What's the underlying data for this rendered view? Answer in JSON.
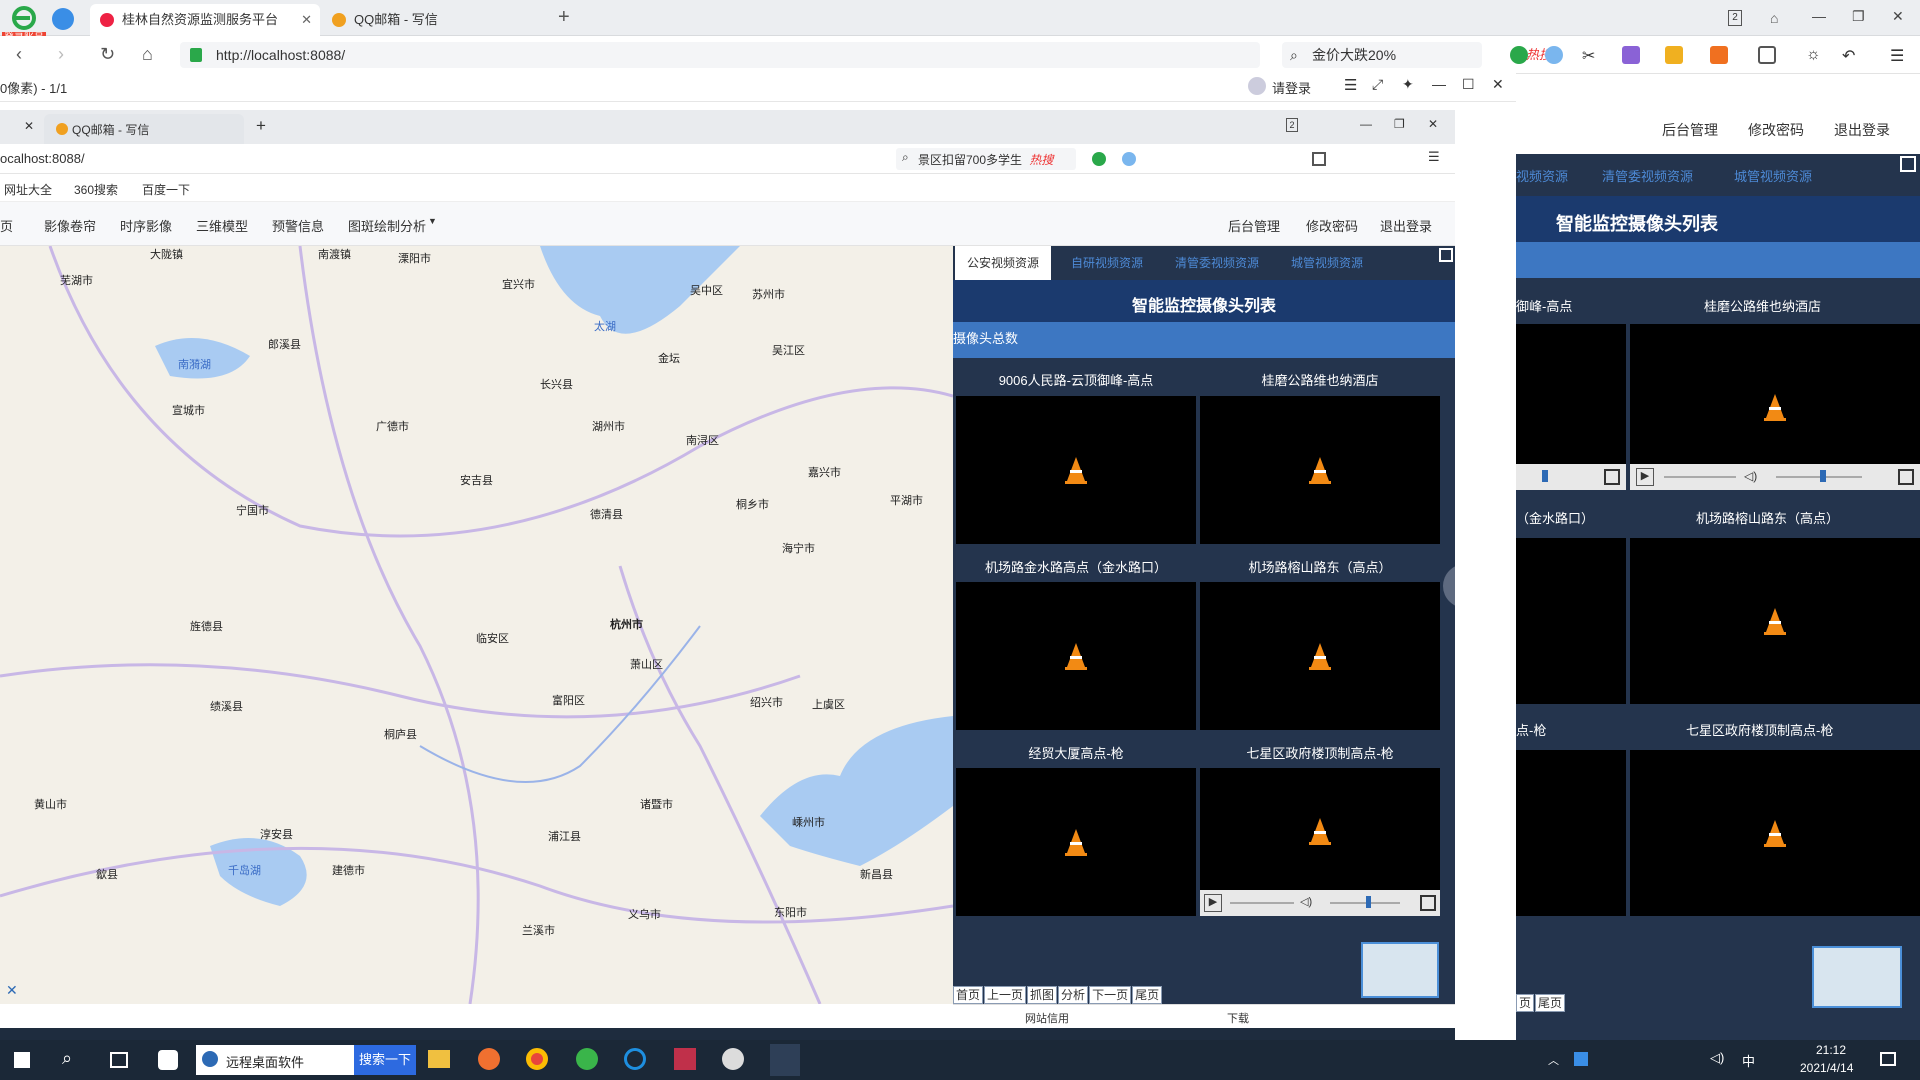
{
  "outer_browser": {
    "login_badge": "登录账号",
    "tabs": [
      {
        "label": "桂林自然资源监测服务平台",
        "active": true
      },
      {
        "label": "QQ邮箱 - 写信",
        "active": false
      }
    ],
    "url": "http://localhost:8088/",
    "search_placeholder": "金价大跌20%",
    "hot_label": "热搜",
    "tab_count": "2"
  },
  "remote_window": {
    "title_left": "0像素) - 1/1",
    "login_label": "请登录",
    "inner_tabs": [
      {
        "label": "QQ邮箱 - 写信"
      }
    ],
    "inner_url": "ocalhost:8088/",
    "inner_search": "景区扣留700多学生",
    "inner_hot": "热搜",
    "bookmarks": [
      "网址大全",
      "360搜索",
      "百度一下"
    ],
    "tab_count": "2"
  },
  "app_nav": {
    "items": [
      "页",
      "影像卷帘",
      "时序影像",
      "三维模型",
      "预警信息",
      "图斑绘制分析"
    ],
    "right_items": [
      "后台管理",
      "修改密码",
      "退出登录"
    ]
  },
  "outer_nav": {
    "right_items": [
      "后台管理",
      "修改密码",
      "退出登录"
    ]
  },
  "camera_panel": {
    "tabs": [
      "公安视频资源",
      "自研视频资源",
      "清管委视频资源",
      "城管视频资源"
    ],
    "title": "智能监控摄像头列表",
    "total_label": "摄像头总数",
    "cameras": [
      {
        "name": "9006人民路-云顶御峰-高点"
      },
      {
        "name": "桂磨公路维也纳酒店"
      },
      {
        "name": "机场路金水路高点（金水路口）"
      },
      {
        "name": "机场路榕山路东（高点）"
      },
      {
        "name": "经贸大厦高点-枪"
      },
      {
        "name": "七星区政府楼顶制高点-枪"
      }
    ],
    "pager": [
      "首页",
      "上一页",
      "抓图",
      "分析",
      "下一页",
      "尾页"
    ]
  },
  "right_panel": {
    "tabs": [
      "视频资源",
      "清管委视频资源",
      "城管视频资源"
    ],
    "title": "智能监控摄像头列表",
    "cameras": [
      {
        "name": "御峰-高点"
      },
      {
        "name": "桂磨公路维也纳酒店"
      },
      {
        "name": "（金水路口）"
      },
      {
        "name": "机场路榕山路东（高点）"
      },
      {
        "name": "点-枪"
      },
      {
        "name": "七星区政府楼顶制高点-枪"
      }
    ],
    "pager": [
      "页",
      "尾页"
    ]
  },
  "map": {
    "cities": [
      {
        "name": "芜湖市"
      },
      {
        "name": "大陇镇"
      },
      {
        "name": "南渡镇"
      },
      {
        "name": "溧阳市"
      },
      {
        "name": "宜兴市"
      },
      {
        "name": "苏州市"
      },
      {
        "name": "吴中区"
      },
      {
        "name": "吴江区"
      },
      {
        "name": "湖州市"
      },
      {
        "name": "南浔区"
      },
      {
        "name": "嘉兴市"
      },
      {
        "name": "宣城市"
      },
      {
        "name": "广德市"
      },
      {
        "name": "长兴县"
      },
      {
        "name": "德清县"
      },
      {
        "name": "杭州市"
      },
      {
        "name": "萧山区"
      },
      {
        "name": "绍兴市"
      },
      {
        "name": "上虞区"
      },
      {
        "name": "诸暨市"
      },
      {
        "name": "富阳区"
      },
      {
        "name": "临安区"
      },
      {
        "name": "桐乡市"
      },
      {
        "name": "海宁市"
      },
      {
        "name": "平湖市"
      },
      {
        "name": "黄山市"
      },
      {
        "name": "宁国市"
      },
      {
        "name": "郎溪县"
      },
      {
        "name": "安吉县"
      },
      {
        "name": "桐庐县"
      },
      {
        "name": "建德市"
      },
      {
        "name": "淳安县"
      },
      {
        "name": "浦江县"
      },
      {
        "name": "义乌市"
      },
      {
        "name": "东阳市"
      },
      {
        "name": "嵊州市"
      },
      {
        "name": "新昌县"
      },
      {
        "name": "兰溪市"
      },
      {
        "name": "金坛"
      },
      {
        "name": "太湖"
      },
      {
        "name": "千岛湖"
      },
      {
        "name": "南漪湖"
      },
      {
        "name": "歙县"
      },
      {
        "name": "绩溪县"
      },
      {
        "name": "旌德县"
      }
    ]
  },
  "taskbar": {
    "search_text": "远程桌面软件",
    "search_button": "搜索一下",
    "time": "21:12",
    "date": "2021/4/14",
    "lang": "中"
  },
  "status_bar": {
    "items": [
      "网站信用",
      "下载"
    ]
  }
}
